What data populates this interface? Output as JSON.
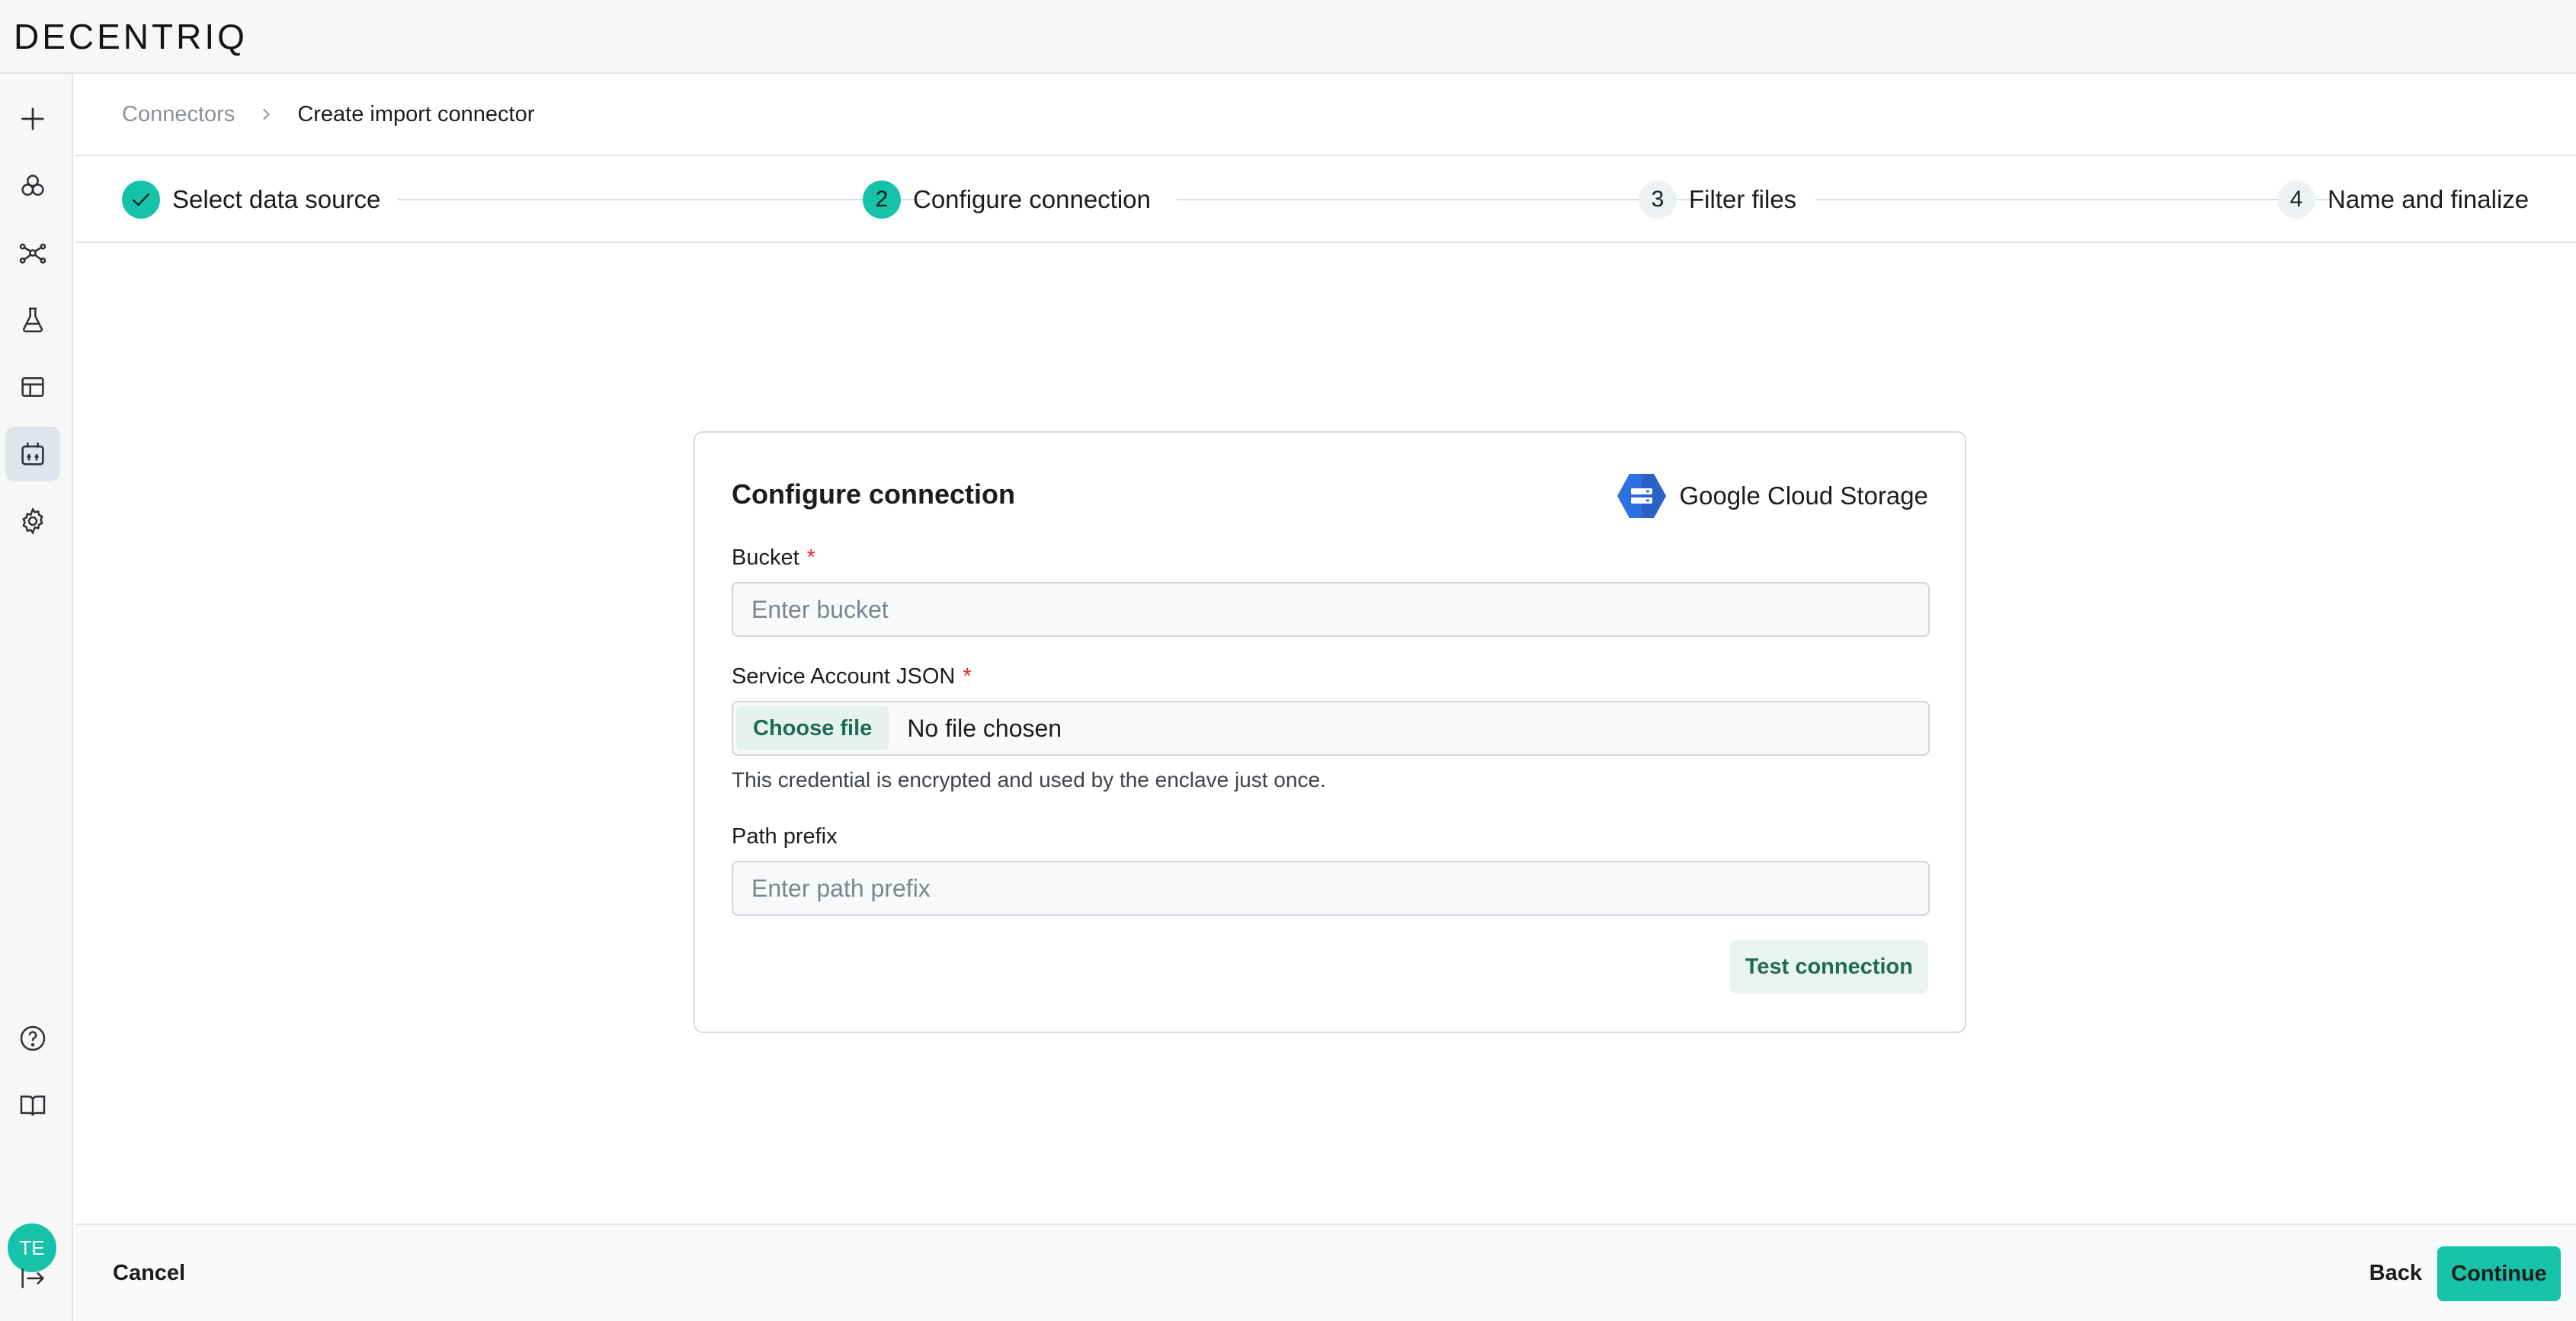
{
  "app": {
    "logo": "DECENTRIQ"
  },
  "sidebar": {
    "items": [
      {
        "icon": "plus-icon"
      },
      {
        "icon": "data-clean-rooms-icon"
      },
      {
        "icon": "network-icon"
      },
      {
        "icon": "lab-flask-icon"
      },
      {
        "icon": "table-icon"
      },
      {
        "icon": "connectors-icon",
        "active": true
      },
      {
        "icon": "gear-icon"
      }
    ],
    "bottom": [
      {
        "icon": "help-icon"
      },
      {
        "icon": "docs-book-icon"
      }
    ],
    "avatar": "TE",
    "collapse_icon": "collapse-sidebar-icon"
  },
  "breadcrumb": {
    "parent": "Connectors",
    "current": "Create import connector"
  },
  "stepper": {
    "steps": [
      {
        "number": "",
        "label": "Select data source",
        "state": "done"
      },
      {
        "number": "2",
        "label": "Configure connection",
        "state": "current"
      },
      {
        "number": "3",
        "label": "Filter files",
        "state": "todo"
      },
      {
        "number": "4",
        "label": "Name and finalize",
        "state": "todo"
      }
    ]
  },
  "card": {
    "title": "Configure connection",
    "provider": "Google Cloud Storage",
    "bucket": {
      "label": "Bucket",
      "required": "*",
      "placeholder": "Enter bucket",
      "value": ""
    },
    "service_account": {
      "label": "Service Account JSON",
      "required": "*",
      "button": "Choose file",
      "status": "No file chosen",
      "helper": "This credential is encrypted and used by the enclave just once."
    },
    "path_prefix": {
      "label": "Path prefix",
      "placeholder": "Enter path prefix",
      "value": ""
    },
    "test_button": "Test connection"
  },
  "footer": {
    "cancel": "Cancel",
    "back": "Back",
    "continue": "Continue"
  },
  "colors": {
    "accent": "#16c3a8",
    "required": "#e5262a",
    "secondary_button_text": "#1e6b57"
  }
}
